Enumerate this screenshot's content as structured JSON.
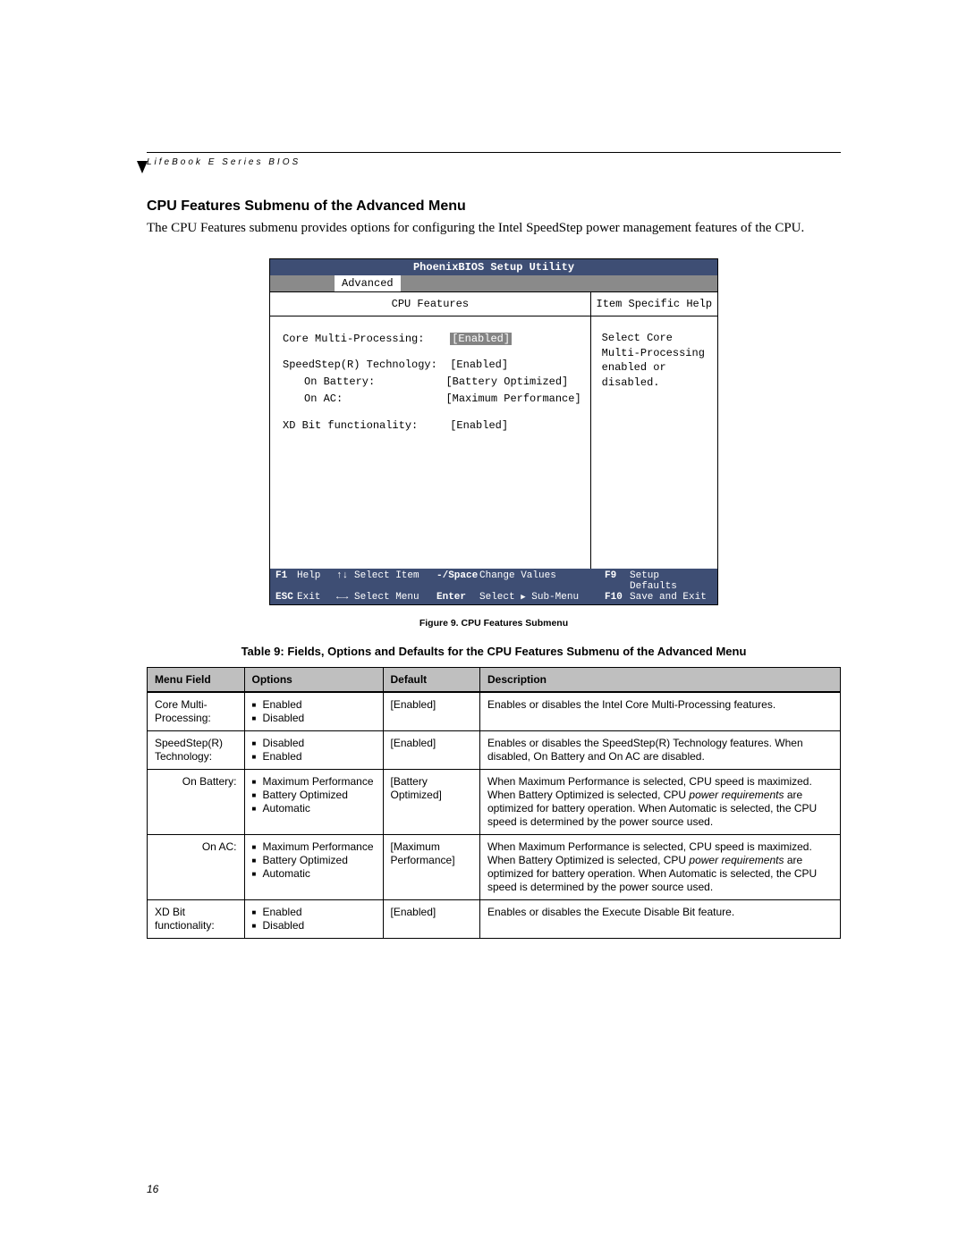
{
  "doc": {
    "running_head": "LifeBook E Series BIOS",
    "section_title": "CPU Features Submenu of the Advanced Menu",
    "intro": "The CPU Features submenu provides options for configuring the Intel SpeedStep power management features of the CPU.",
    "page_number": "16",
    "figure_caption": "Figure 9.  CPU Features Submenu",
    "table_caption": "Table 9: Fields, Options and Defaults for the CPU Features Submenu of the Advanced Menu"
  },
  "bios": {
    "title": "PhoenixBIOS Setup Utility",
    "active_tab": "Advanced",
    "left_header": "CPU Features",
    "right_header": "Item Specific Help",
    "help_text": "Select Core Multi-Processing enabled or disabled.",
    "fields": [
      {
        "label": "Core Multi-Processing:",
        "value": "[Enabled]",
        "selected": true
      },
      {
        "gap": true
      },
      {
        "label": "SpeedStep(R) Technology:",
        "value": "[Enabled]"
      },
      {
        "label": "On Battery:",
        "value": "[Battery Optimized]",
        "indent": true
      },
      {
        "label": "On AC:",
        "value": "[Maximum Performance]",
        "indent": true
      },
      {
        "gap": true
      },
      {
        "label": "XD Bit functionality:",
        "value": "[Enabled]"
      }
    ],
    "footer": {
      "row1": {
        "k1": "F1",
        "t1": "Help",
        "arr1": "↑↓",
        "t2": "Select Item",
        "k2": "-/Space",
        "t3": "Change Values",
        "k3": "F9",
        "t4": "Setup Defaults"
      },
      "row2": {
        "k1": "ESC",
        "t1": "Exit",
        "arr1": "←→",
        "t2": "Select Menu",
        "k2": "Enter",
        "t3a": "Select ",
        "t3b": " Sub-Menu",
        "k3": "F10",
        "t4": "Save and Exit"
      }
    }
  },
  "table": {
    "headers": {
      "c1": "Menu Field",
      "c2": "Options",
      "c3": "Default",
      "c4": "Description"
    },
    "rows": [
      {
        "field": "Core Multi-Processing:",
        "options": [
          "Enabled",
          "Disabled"
        ],
        "def": "[Enabled]",
        "desc_plain": "Enables or disables the Intel Core Multi-Processing features."
      },
      {
        "field": "SpeedStep(R) Technology:",
        "options": [
          "Disabled",
          "Enabled"
        ],
        "def": "[Enabled]",
        "desc_plain": "Enables or disables the SpeedStep(R) Technology features. When disabled, On Battery and On AC are disabled."
      },
      {
        "field": "On Battery:",
        "sub": true,
        "options": [
          "Maximum Performance",
          "Battery Optimized",
          "Automatic"
        ],
        "def": "[Battery Optimized]",
        "desc_pre": "When Maximum Performance is selected, CPU speed is maximized. When Battery Optimized is selected, CPU ",
        "desc_em": "power requirements",
        "desc_post": " are optimized for battery operation. When Automatic is selected, the CPU speed is determined by the power source used."
      },
      {
        "field": "On AC:",
        "sub": true,
        "options": [
          "Maximum Performance",
          "Battery Optimized",
          "Automatic"
        ],
        "def": "[Maximum Performance]",
        "desc_pre": "When Maximum Performance is selected, CPU speed is maximized. When Battery Optimized is selected, CPU ",
        "desc_em": "power requirements",
        "desc_post": " are optimized for battery operation. When Automatic is selected, the CPU speed is determined by the power source used."
      },
      {
        "field": "XD Bit functionality:",
        "options": [
          "Enabled",
          "Disabled"
        ],
        "def": "[Enabled]",
        "desc_plain": "Enables or disables the Execute Disable Bit feature."
      }
    ]
  }
}
